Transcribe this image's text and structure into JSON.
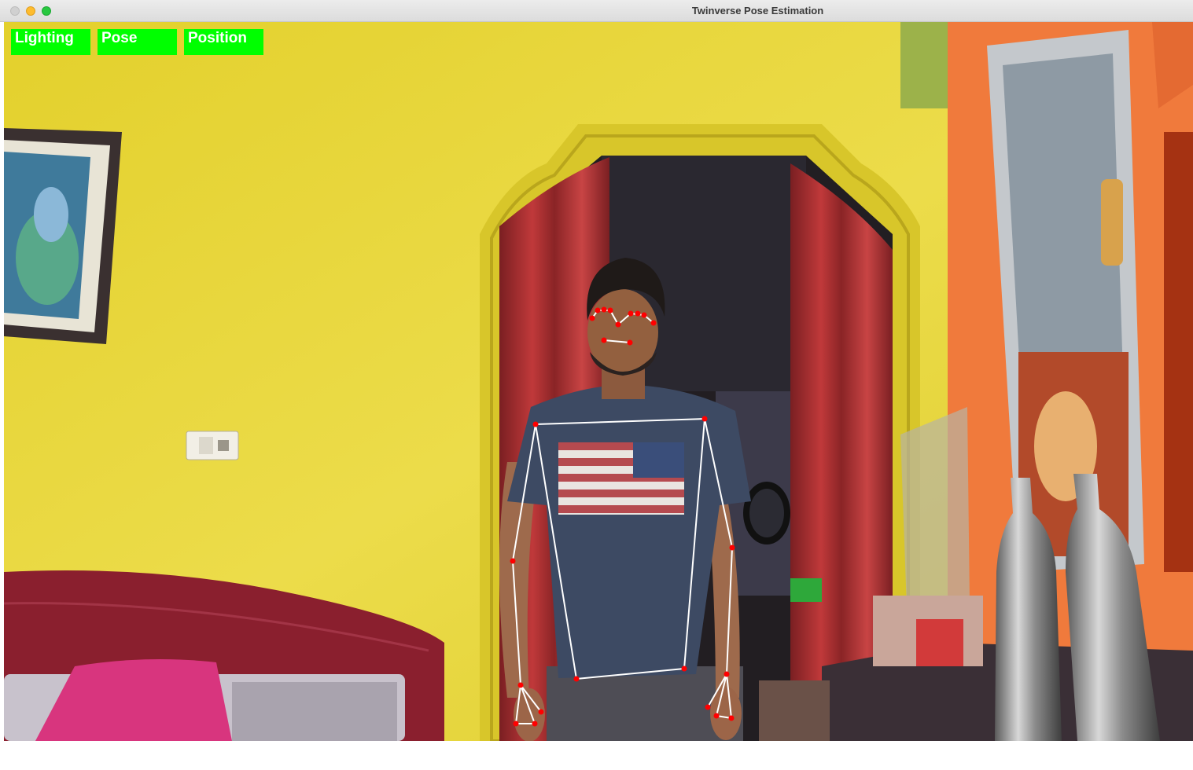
{
  "window": {
    "title": "Twinverse Pose Estimation"
  },
  "status_indicators": [
    {
      "label": "Lighting",
      "color": "#00ff00"
    },
    {
      "label": "Pose",
      "color": "#00ff00"
    },
    {
      "label": "Position",
      "color": "#00ff00"
    }
  ],
  "colors": {
    "landmark": "#ff0000",
    "skeleton": "#ffffff",
    "wall": "#e6d835",
    "cabinet": "#f07a3c",
    "indicator": "#00ff00"
  },
  "icons": {
    "close": "traffic-light-close-icon",
    "minimize": "traffic-light-minimize-icon",
    "maximize": "traffic-light-maximize-icon"
  }
}
